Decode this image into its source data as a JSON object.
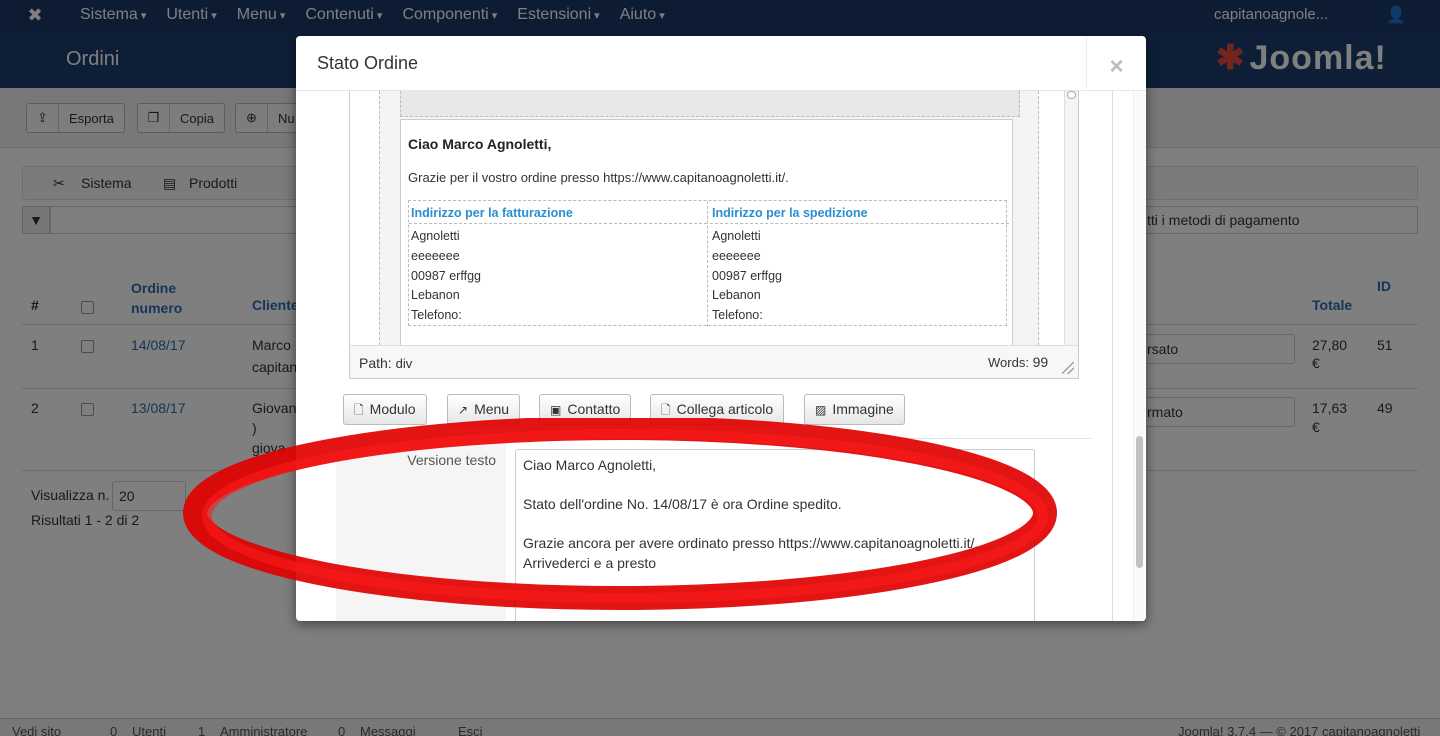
{
  "topnav": {
    "menu": [
      "Sistema",
      "Utenti",
      "Menu",
      "Contenuti",
      "Componenti",
      "Estensioni",
      "Aiuto"
    ],
    "user": "capitanoagnole..."
  },
  "header": {
    "title": "Ordini",
    "brand": "Joomla!"
  },
  "toolbar": {
    "export": "Esporta",
    "copy": "Copia",
    "new": "Nu"
  },
  "submenu": {
    "system": "Sistema",
    "products": "Prodotti"
  },
  "filters": {
    "payment": "tti i metodi di pagamento"
  },
  "table": {
    "headers": {
      "num": "#",
      "order": "Ordine\nnumero",
      "client": "Cliente",
      "total": "Totale",
      "id": "ID"
    },
    "rows": [
      {
        "num": "1",
        "date": "14/08/17",
        "client1": "Marco",
        "client2": "capitan",
        "status": "rsato",
        "total": "27,80",
        "currency": "€",
        "id": "51"
      },
      {
        "num": "2",
        "date": "13/08/17",
        "client1": "Giovan",
        "client2": ")",
        "client3": "giova",
        "status": "rmato",
        "total": "17,63",
        "currency": "€",
        "id": "49"
      }
    ]
  },
  "pagination": {
    "label": "Visualizza n.",
    "value": "20",
    "results": "Risultati 1 - 2 di 2"
  },
  "statusbar": {
    "view_site": "Vedi sito",
    "users_count": "0",
    "users": "Utenti",
    "admins_count": "1",
    "admins": "Amministratore",
    "messages_count": "0",
    "messages": "Messaggi",
    "logout": "Esci",
    "version": "Joomla! 3.7.4 — © 2017 capitanoagnoletti"
  },
  "modal": {
    "title": "Stato Ordine",
    "close": "×",
    "email": {
      "greeting": "Ciao Marco Agnoletti,",
      "thanks": "Grazie per il vostro ordine presso https://www.capitanoagnoletti.it/.",
      "billing_title": "Indirizzo per la fatturazione",
      "shipping_title": "Indirizzo per la spedizione",
      "billing_lines": [
        "Agnoletti",
        "eeeeeee",
        "00987 erffgg",
        "Lebanon",
        "Telefono:"
      ],
      "shipping_lines": [
        "Agnoletti",
        "eeeeeee",
        "00987 erffgg",
        "Lebanon",
        "Telefono:"
      ]
    },
    "path_label": "Path:",
    "path_value": "div",
    "words_label": "Words:",
    "words_value": "99",
    "buttons": [
      "Modulo",
      "Menu",
      "Contatto",
      "Collega articolo",
      "Immagine"
    ],
    "text_version_label": "Versione testo",
    "text_version": [
      "Ciao Marco Agnoletti,",
      "Stato dell'ordine No. 14/08/17 è ora Ordine spedito.",
      "Grazie ancora per avere ordinato presso https://www.capitanoagnoletti.it/.",
      "Arrivederci e a presto"
    ]
  },
  "colors": {
    "nav": "#1a3867",
    "link": "#2a6db0",
    "accent_blue": "#2a8fd0",
    "annotation": "#e00000"
  }
}
